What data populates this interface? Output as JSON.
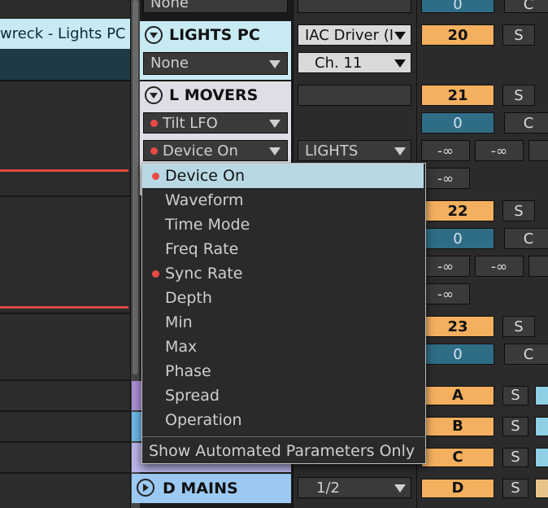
{
  "arrangement": {
    "clip_label": "wreck - Lights PC"
  },
  "tracks": {
    "top_partial": {
      "input_type": "None",
      "number_label": "0",
      "button_label": "C"
    },
    "lights_pc": {
      "name": "LIGHTS PC",
      "device": "None",
      "midi_to": "IAC Driver (I",
      "channel": "Ch. 11",
      "number": "20",
      "solo": "S"
    },
    "l_movers": {
      "name": "L MOVERS",
      "device": "Tilt LFO",
      "param": "Device On",
      "output": "LIGHTS",
      "number": "21",
      "solo": "S",
      "monitor": "0",
      "button": "C",
      "inf1": "-∞",
      "inf2": "-∞",
      "inf3": "-∞"
    },
    "track22": {
      "number": "22",
      "solo": "S",
      "monitor": "0",
      "button": "C",
      "inf1": "-∞",
      "inf2": "-∞",
      "inf3": "-∞"
    },
    "track23": {
      "number": "23",
      "solo": "S",
      "monitor": "0",
      "button": "C"
    },
    "return_a": {
      "number": "A",
      "solo": "S"
    },
    "return_b": {
      "number": "B",
      "solo": "S"
    },
    "return_c": {
      "number": "C",
      "solo": "S"
    },
    "d_mains": {
      "name": "D MAINS",
      "output": "1/2",
      "number": "D",
      "solo": "S"
    }
  },
  "param_menu": {
    "items": [
      {
        "label": "Device On",
        "selected": true,
        "automated": true
      },
      {
        "label": "Waveform",
        "automated": false
      },
      {
        "label": "Time Mode",
        "automated": false
      },
      {
        "label": "Freq Rate",
        "automated": false
      },
      {
        "label": "Sync Rate",
        "automated": true
      },
      {
        "label": "Depth",
        "automated": false
      },
      {
        "label": "Min",
        "automated": false
      },
      {
        "label": "Max",
        "automated": false
      },
      {
        "label": "Phase",
        "automated": false
      },
      {
        "label": "Spread",
        "automated": false
      },
      {
        "label": "Operation",
        "automated": false
      }
    ],
    "footer": "Show Automated Parameters Only"
  },
  "colors": {
    "track_light_blue": "#c7eaf3",
    "track_lavender": "#e1dde6",
    "track_blue": "#9cc9f2",
    "number_orange": "#f4b05f",
    "monitor_blue": "#2f6d87",
    "automation_red": "#e94a44",
    "menu_selected": "#b8d8e4"
  }
}
